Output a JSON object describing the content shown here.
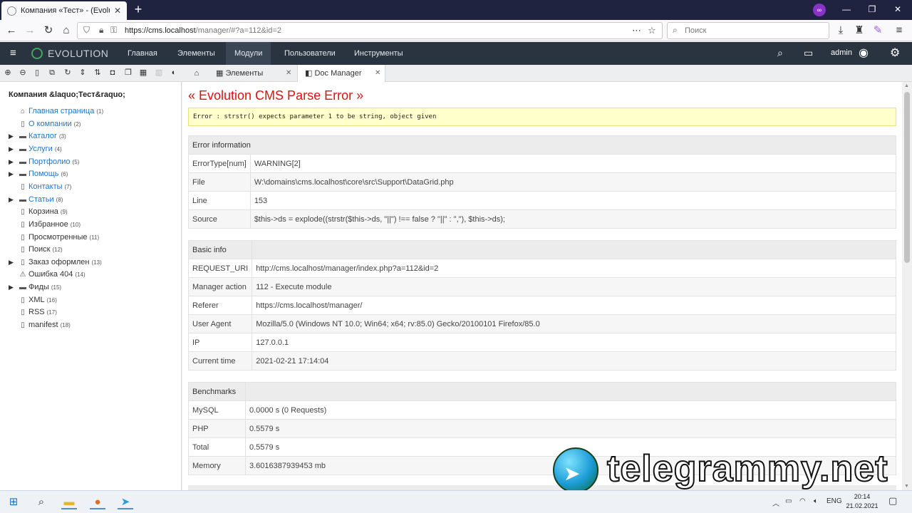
{
  "browser": {
    "tab_title": "Компания «Тест» - (Evolution",
    "url_domain": "https://cms.localhost",
    "url_path": "/manager/#?a=112&id=2",
    "search_placeholder": "Поиск"
  },
  "header": {
    "brand": "EVOLUTION",
    "menu": [
      "Главная",
      "Элементы",
      "Модули",
      "Пользователи",
      "Инструменты"
    ],
    "active_menu": "Модули",
    "user": "admin"
  },
  "tree": {
    "site_name": "Компания &laquo;Тест&raquo;",
    "nodes": [
      {
        "label": "Главная страница",
        "count": "(1)",
        "icon": "home-icon",
        "link": true,
        "arrow": false
      },
      {
        "label": "О компании",
        "count": "(2)",
        "icon": "page-icon",
        "link": true,
        "arrow": false
      },
      {
        "label": "Каталог",
        "count": "(3)",
        "icon": "folder-icon",
        "link": true,
        "arrow": true
      },
      {
        "label": "Услуги",
        "count": "(4)",
        "icon": "folder-icon",
        "link": true,
        "arrow": true
      },
      {
        "label": "Портфолио",
        "count": "(5)",
        "icon": "folder-icon",
        "link": true,
        "arrow": true
      },
      {
        "label": "Помощь",
        "count": "(6)",
        "icon": "folder-icon",
        "link": true,
        "arrow": true
      },
      {
        "label": "Контакты",
        "count": "(7)",
        "icon": "page-icon",
        "link": true,
        "arrow": false
      },
      {
        "label": "Статьи",
        "count": "(8)",
        "icon": "folder-icon",
        "link": true,
        "arrow": true
      },
      {
        "label": "Корзина",
        "count": "(9)",
        "icon": "page-icon",
        "link": false,
        "arrow": false
      },
      {
        "label": "Избранное",
        "count": "(10)",
        "icon": "page-icon",
        "link": false,
        "arrow": false
      },
      {
        "label": "Просмотренные",
        "count": "(11)",
        "icon": "page-icon",
        "link": false,
        "arrow": false
      },
      {
        "label": "Поиск",
        "count": "(12)",
        "icon": "page-icon",
        "link": false,
        "arrow": false
      },
      {
        "label": "Заказ оформлен",
        "count": "(13)",
        "icon": "page-icon",
        "link": false,
        "arrow": true
      },
      {
        "label": "Ошибка 404",
        "count": "(14)",
        "icon": "warning-icon",
        "link": false,
        "arrow": false
      },
      {
        "label": "Фиды",
        "count": "(15)",
        "icon": "folder-icon",
        "link": false,
        "arrow": true
      },
      {
        "label": "XML",
        "count": "(16)",
        "icon": "code-file-icon",
        "link": false,
        "arrow": false
      },
      {
        "label": "RSS",
        "count": "(17)",
        "icon": "page-icon",
        "link": false,
        "arrow": false
      },
      {
        "label": "manifest",
        "count": "(18)",
        "icon": "page-icon",
        "link": false,
        "arrow": false
      }
    ]
  },
  "tabs": [
    {
      "label": "Элементы"
    },
    {
      "label": "Doc Manager"
    }
  ],
  "error": {
    "title": "« Evolution CMS Parse Error »",
    "message": "Error : strstr() expects parameter 1 to be string, object given"
  },
  "error_info": {
    "heading": "Error information",
    "rows": [
      {
        "key": "ErrorType[num]",
        "value": "WARNING[2]"
      },
      {
        "key": "File",
        "value": "W:\\domains\\cms.localhost\\core\\src\\Support\\DataGrid.php"
      },
      {
        "key": "Line",
        "value": "153"
      },
      {
        "key": "Source",
        "value": "$this->ds = explode((strstr($this->ds, \"||\") !== false ? \"||\" : \",\"), $this->ds);"
      }
    ]
  },
  "basic_info": {
    "heading": "Basic info",
    "rows": [
      {
        "key": "REQUEST_URI",
        "value": "http://cms.localhost/manager/index.php?a=112&id=2"
      },
      {
        "key": "Manager action",
        "value": "112 - Execute module"
      },
      {
        "key": "Referer",
        "value": "https://cms.localhost/manager/"
      },
      {
        "key": "User Agent",
        "value": "Mozilla/5.0 (Windows NT 10.0; Win64; x64; rv:85.0) Gecko/20100101 Firefox/85.0"
      },
      {
        "key": "IP",
        "value": "127.0.0.1"
      },
      {
        "key": "Current time",
        "value": "2021-02-21 17:14:04"
      }
    ]
  },
  "benchmarks": {
    "heading": "Benchmarks",
    "rows": [
      {
        "key": "MySQL",
        "value": "0.0000 s (0 Requests)"
      },
      {
        "key": "PHP",
        "value": "0.5579 s"
      },
      {
        "key": "Total",
        "value": "0.5579 s"
      },
      {
        "key": "Memory",
        "value": "3.6016387939453 mb"
      }
    ]
  },
  "watermark": "telegrammy.net",
  "taskbar": {
    "lang": "ENG",
    "time": "20:14",
    "date": "21.02.2021"
  }
}
